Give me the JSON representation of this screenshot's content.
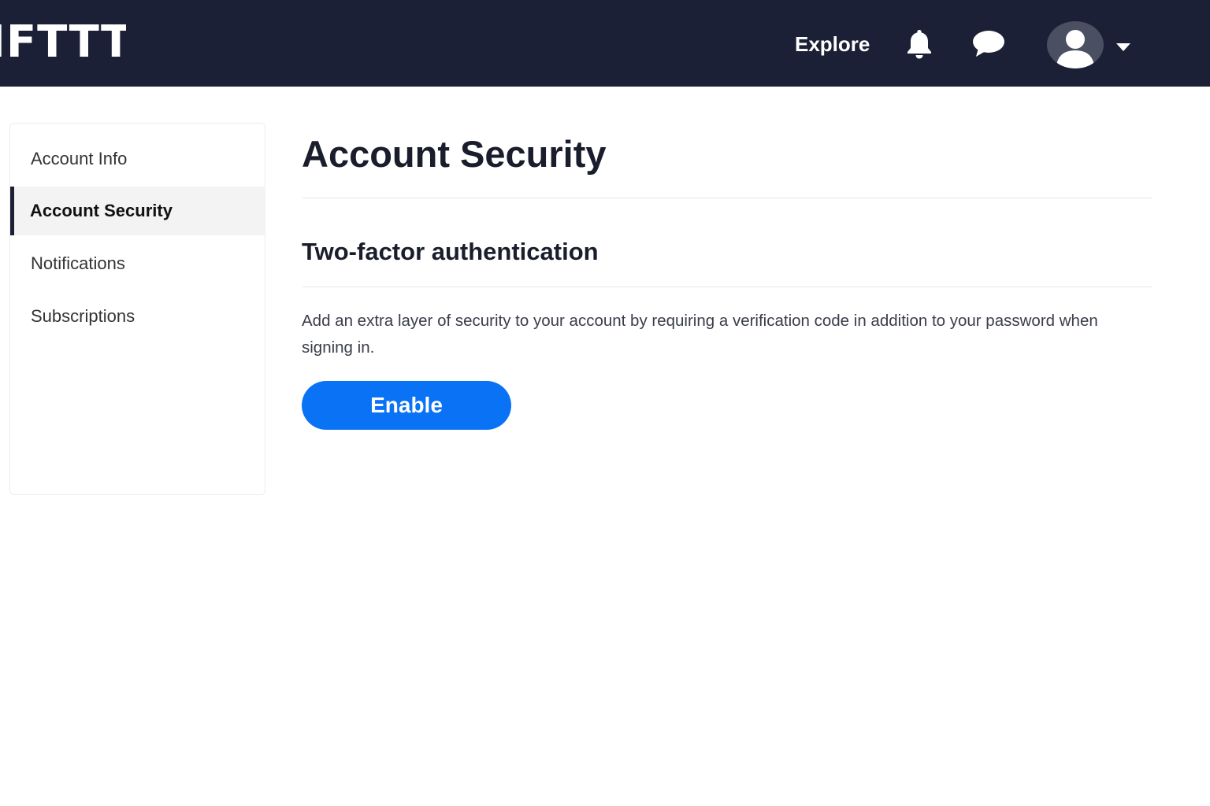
{
  "header": {
    "logo_text": "IFTTT",
    "explore_label": "Explore",
    "icons": {
      "notifications": "bell-icon",
      "messages": "chat-bubble-icon",
      "profile": "user-avatar-icon",
      "menu": "caret-down-icon"
    },
    "background_color": "#1b2036"
  },
  "sidebar": {
    "items": [
      {
        "label": "Account Info",
        "active": false
      },
      {
        "label": "Account Security",
        "active": true
      },
      {
        "label": "Notifications",
        "active": false
      },
      {
        "label": "Subscriptions",
        "active": false
      }
    ]
  },
  "main": {
    "title": "Account Security",
    "section": {
      "title": "Two-factor authentication",
      "description": "Add an extra layer of security to your account by requiring a verification code in addition to your password when signing in.",
      "button_label": "Enable",
      "button_color": "#0a72f5"
    }
  }
}
